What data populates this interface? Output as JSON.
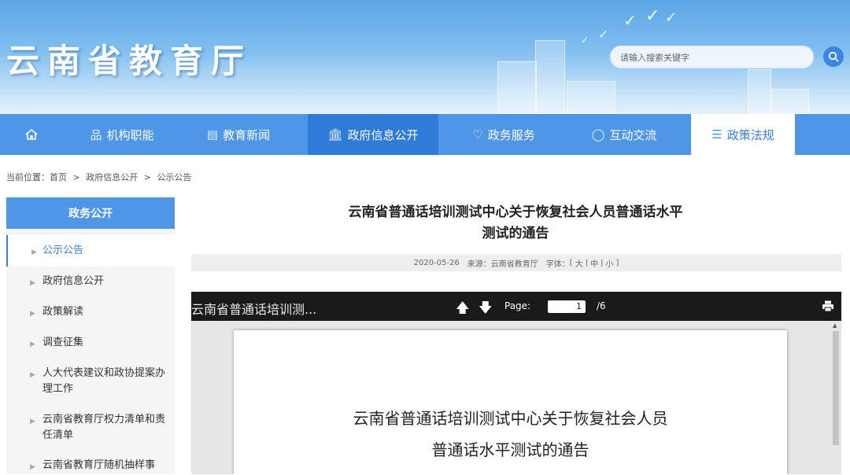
{
  "header": {
    "site_title": "云南省教育厅",
    "search_placeholder": "请输入搜索关键字"
  },
  "nav": {
    "home_icon": "home-icon",
    "items": [
      {
        "label": "机构职能",
        "icon": "org-chart-icon"
      },
      {
        "label": "教育新闻",
        "icon": "news-icon"
      },
      {
        "label": "政府信息公开",
        "icon": "government-building-icon"
      },
      {
        "label": "政务服务",
        "icon": "heart-hands-icon"
      },
      {
        "label": "互动交流",
        "icon": "chat-icon"
      },
      {
        "label": "政策法规",
        "icon": "list-icon"
      }
    ]
  },
  "breadcrumb": {
    "prefix": "当前位置：",
    "items": [
      "首页",
      "政府信息公开",
      "公示公告"
    ],
    "separator": ">"
  },
  "sidebar": {
    "title": "政务公开",
    "items": [
      {
        "label": "公示公告",
        "active": true
      },
      {
        "label": "政府信息公开"
      },
      {
        "label": "政策解读"
      },
      {
        "label": "调查征集"
      },
      {
        "label": "人大代表建议和政协提案办理工作"
      },
      {
        "label": "云南省教育厅权力清单和责任清单"
      },
      {
        "label": "云南省教育厅随机抽样事"
      }
    ]
  },
  "article": {
    "title_line1": "云南省普通话培训测试中心关于恢复社会人员普通话水平",
    "title_line2": "测试的通告",
    "date": "2020-05-26",
    "source_label": "来源：",
    "source": "云南省教育厅",
    "font_label": "字体：",
    "font_sizes": [
      "大",
      "中",
      "小"
    ]
  },
  "viewer": {
    "doc_name": "云南省普通话培训测...",
    "page_label": "Page:",
    "current_page": "1",
    "total_pages": "/6",
    "paper_title_line1": "云南省普通话培训测试中心关于恢复社会人员",
    "paper_title_line2": "普通话水平测试的通告"
  },
  "colors": {
    "nav_blue": "#4f97e6",
    "nav_active": "#2f7bd7",
    "link_blue": "#3a7fd6"
  }
}
